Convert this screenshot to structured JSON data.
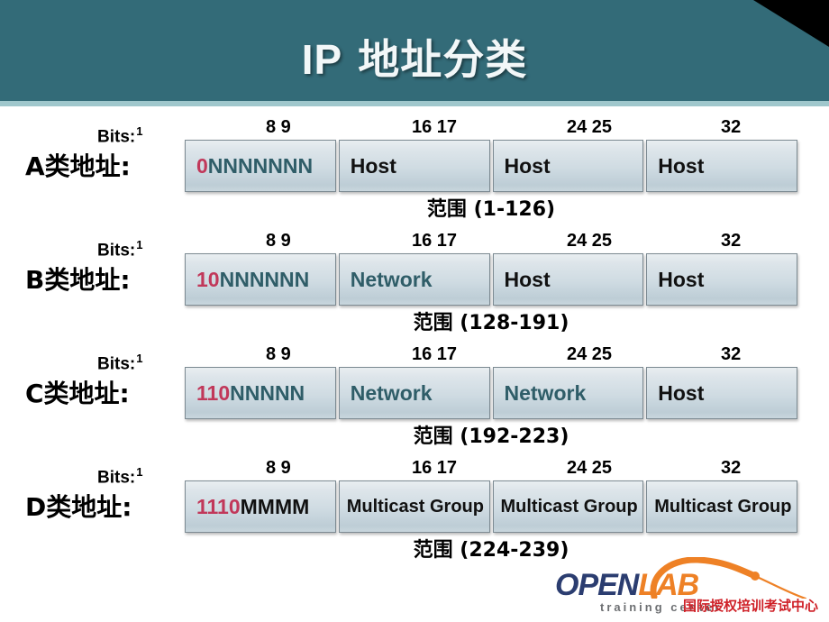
{
  "slide": {
    "title_latin": "IP",
    "title_cn": "地址分类"
  },
  "ticks": {
    "start": "1",
    "t8": "8  9",
    "t16": "16 17",
    "t24": "24 25",
    "t32": "32"
  },
  "common": {
    "bits_label": "Bits:"
  },
  "rows": [
    {
      "class_label": "A类地址:",
      "cells": [
        {
          "prefix": "0",
          "suffix": "NNNNNNN",
          "suffix_color": "teal",
          "kind": "bits"
        },
        {
          "text": "Host",
          "color": "dark",
          "kind": "word"
        },
        {
          "text": "Host",
          "color": "dark",
          "kind": "word"
        },
        {
          "text": "Host",
          "color": "dark",
          "kind": "word"
        }
      ],
      "range": "范围 (1-126)"
    },
    {
      "class_label": "B类地址:",
      "cells": [
        {
          "prefix": "10",
          "suffix": "NNNNNN",
          "suffix_color": "teal",
          "kind": "bits"
        },
        {
          "text": "Network",
          "color": "teal",
          "kind": "word"
        },
        {
          "text": "Host",
          "color": "dark",
          "kind": "word"
        },
        {
          "text": "Host",
          "color": "dark",
          "kind": "word"
        }
      ],
      "range": "范围 (128-191)"
    },
    {
      "class_label": "C类地址:",
      "cells": [
        {
          "prefix": "110",
          "suffix": "NNNNN",
          "suffix_color": "teal",
          "kind": "bits"
        },
        {
          "text": "Network",
          "color": "teal",
          "kind": "word"
        },
        {
          "text": "Network",
          "color": "teal",
          "kind": "word"
        },
        {
          "text": "Host",
          "color": "dark",
          "kind": "word"
        }
      ],
      "range": "范围 (192-223)"
    },
    {
      "class_label": "D类地址:",
      "cells": [
        {
          "prefix": "1110",
          "suffix": "MMMM",
          "suffix_color": "dark",
          "kind": "bits"
        },
        {
          "text": "Multicast Group",
          "color": "dark",
          "kind": "word-small"
        },
        {
          "text": "Multicast Group",
          "color": "dark",
          "kind": "word-small"
        },
        {
          "text": "Multicast Group",
          "color": "dark",
          "kind": "word-small"
        }
      ],
      "range": "范围 (224-239)"
    }
  ],
  "logo": {
    "open": "OPEN",
    "lab": "LAB",
    "sub": "training center",
    "cn": "国际授权培训考试中心"
  },
  "colors": {
    "banner": "#336b78",
    "banner_underline": "#9fc7cc",
    "prefix_red": "#c1385a",
    "network_teal": "#2f5d68",
    "logo_open": "#2b3d70",
    "logo_lab": "#ee8126",
    "logo_cn": "#cf2027"
  }
}
